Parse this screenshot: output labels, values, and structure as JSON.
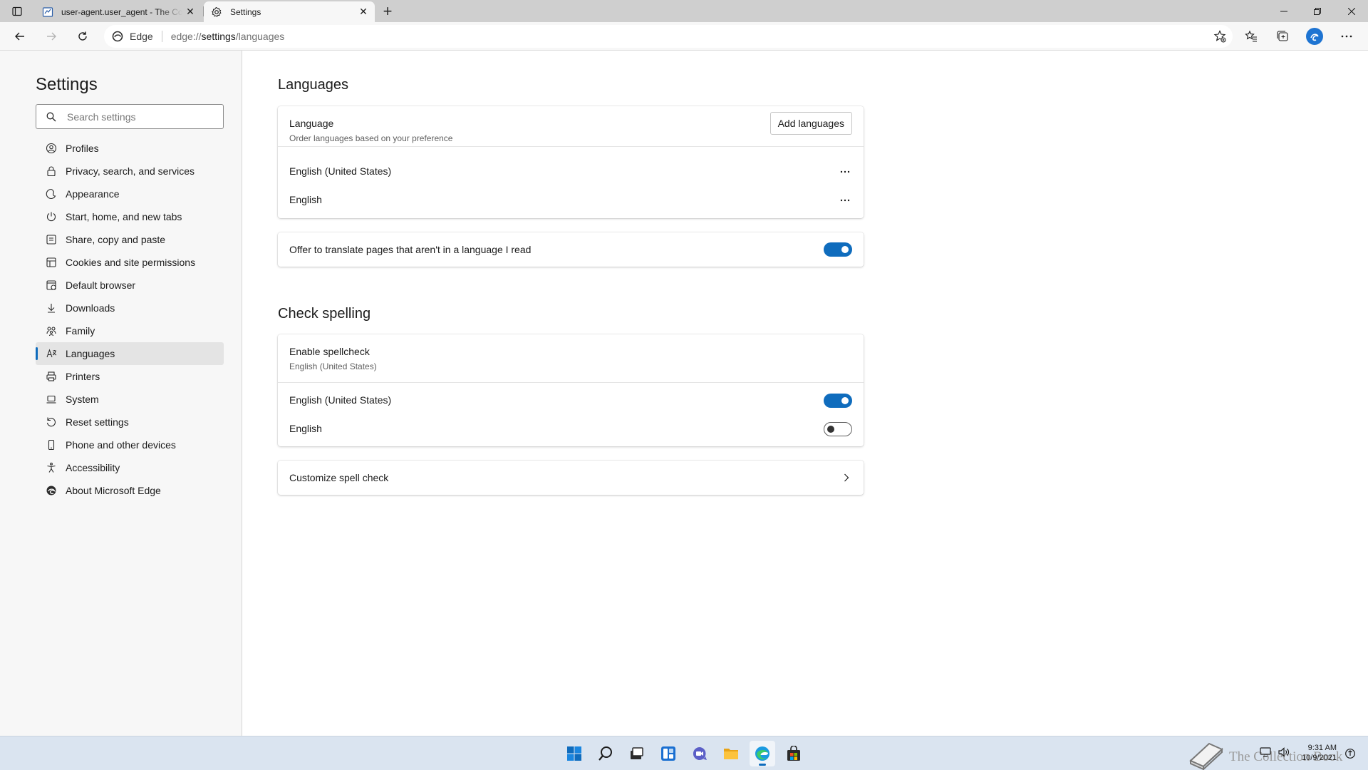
{
  "browser": {
    "tabs": [
      {
        "title": "user-agent.user_agent - The Coll",
        "favicon": "book-icon",
        "active": false
      },
      {
        "title": "Settings",
        "favicon": "gear-icon",
        "active": true
      }
    ],
    "new_tab_symbol": "+",
    "address": {
      "identity_label": "Edge",
      "url_prefix": "edge://",
      "url_host": "settings",
      "url_path": "/languages"
    }
  },
  "sidebar": {
    "title": "Settings",
    "search_placeholder": "Search settings",
    "items": [
      {
        "label": "Profiles",
        "icon": "profile-icon"
      },
      {
        "label": "Privacy, search, and services",
        "icon": "lock-icon"
      },
      {
        "label": "Appearance",
        "icon": "appearance-icon"
      },
      {
        "label": "Start, home, and new tabs",
        "icon": "power-icon"
      },
      {
        "label": "Share, copy and paste",
        "icon": "share-icon"
      },
      {
        "label": "Cookies and site permissions",
        "icon": "cookies-icon"
      },
      {
        "label": "Default browser",
        "icon": "browser-icon"
      },
      {
        "label": "Downloads",
        "icon": "download-icon"
      },
      {
        "label": "Family",
        "icon": "family-icon"
      },
      {
        "label": "Languages",
        "icon": "languages-icon",
        "selected": true
      },
      {
        "label": "Printers",
        "icon": "printer-icon"
      },
      {
        "label": "System",
        "icon": "laptop-icon"
      },
      {
        "label": "Reset settings",
        "icon": "reset-icon"
      },
      {
        "label": "Phone and other devices",
        "icon": "phone-icon"
      },
      {
        "label": "Accessibility",
        "icon": "accessibility-icon"
      },
      {
        "label": "About Microsoft Edge",
        "icon": "edge-icon"
      }
    ]
  },
  "languages": {
    "section_title": "Languages",
    "header_label": "Language",
    "header_sub": "Order languages based on your preference",
    "add_button": "Add languages",
    "list": [
      "English (United States)",
      "English"
    ],
    "translate_label": "Offer to translate pages that aren't in a language I read",
    "translate_on": true
  },
  "spelling": {
    "section_title": "Check spelling",
    "enable_label": "Enable spellcheck",
    "enable_sub": "English (United States)",
    "langs": [
      {
        "label": "English (United States)",
        "on": true
      },
      {
        "label": "English",
        "on": false
      }
    ],
    "customize_label": "Customize spell check"
  },
  "taskbar": {
    "apps": [
      "start-icon",
      "search-icon",
      "task-view-icon",
      "widgets-icon",
      "chat-icon",
      "file-explorer-icon",
      "edge-icon",
      "store-icon"
    ],
    "active_app": "edge-icon",
    "time": "9:31 AM",
    "date": "10/9/2021",
    "watermark_text": "The Collection Book"
  },
  "colors": {
    "accent": "#0f6cbd",
    "sidebar_bg": "#f7f7f7",
    "titlebar_bg": "#cfcfcf",
    "taskbar_bg": "#dae4f0"
  }
}
